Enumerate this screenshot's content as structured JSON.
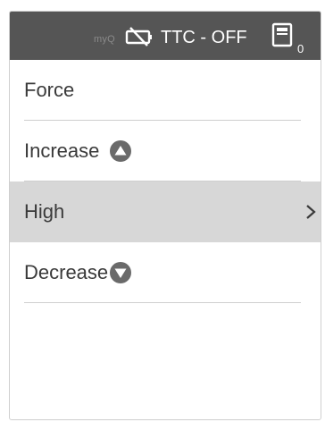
{
  "status_bar": {
    "brand": "myQ",
    "mode_text": "TTC - OFF",
    "device_count": "0",
    "icons": [
      "battery-crossed-icon",
      "device-icon"
    ]
  },
  "menu": {
    "items": [
      {
        "label": "Force",
        "icon": null,
        "selected": false
      },
      {
        "label": "Increase",
        "icon": "arrow-up-circle-icon",
        "selected": false
      },
      {
        "label": "High",
        "icon": "chevron-right-icon",
        "selected": true
      },
      {
        "label": "Decrease",
        "icon": "arrow-down-circle-icon",
        "selected": false
      }
    ]
  },
  "colors": {
    "status_bar_bg": "#555555",
    "selected_row_bg": "#d7d7d7",
    "text": "#3a3a3a",
    "icon_fill": "#6a6a6a"
  }
}
